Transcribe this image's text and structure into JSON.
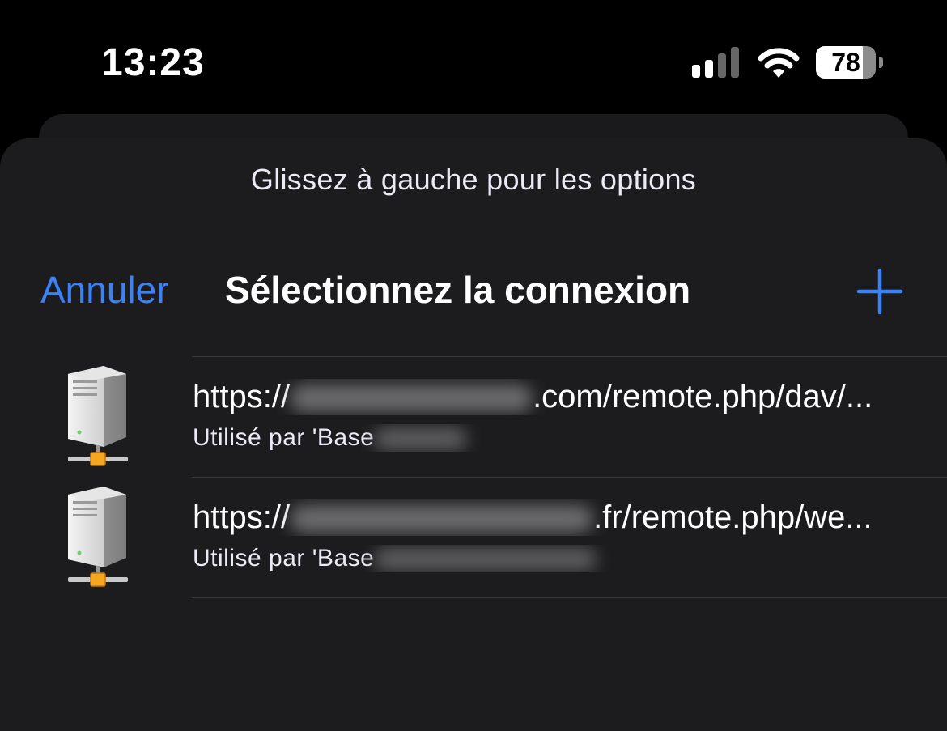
{
  "status_bar": {
    "time": "13:23",
    "battery_percent": 78,
    "battery_label": "78",
    "signal_icon": "cellular-signal-icon",
    "wifi_icon": "wifi-icon"
  },
  "sheet": {
    "hint": "Glissez à gauche pour les options",
    "cancel_label": "Annuler",
    "title": "Sélectionnez la connexion",
    "add_icon": "plus-icon"
  },
  "connections": [
    {
      "url_prefix": "https://",
      "url_suffix": ".com/remote.php/dav/...",
      "used_by": "Utilisé par 'Base",
      "icon": "server-icon"
    },
    {
      "url_prefix": "https://",
      "url_suffix": ".fr/remote.php/we...",
      "used_by": "Utilisé par 'Base",
      "icon": "server-icon"
    }
  ],
  "colors": {
    "accent": "#3b82f6",
    "sheet_background": "#1c1c1e",
    "page_background": "#000000"
  }
}
